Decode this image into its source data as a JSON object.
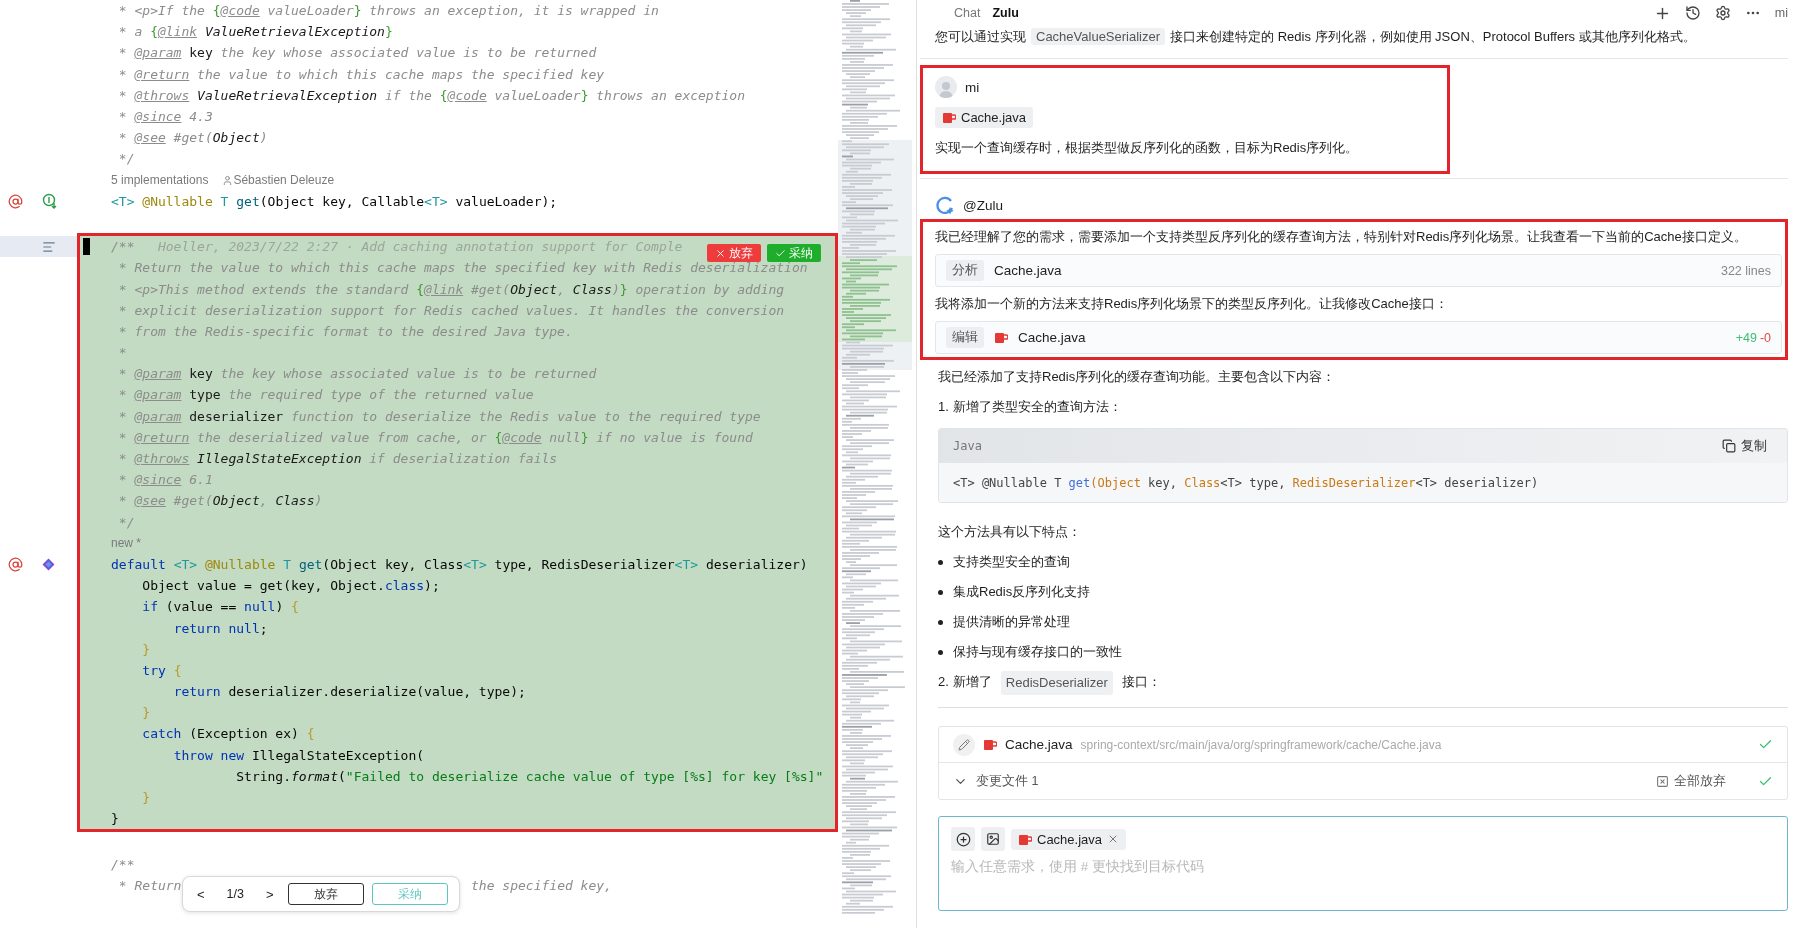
{
  "editor": {
    "lines_before": [
      {
        "kind": "code",
        "tokens": [
          {
            "kind": "comment",
            "text": " * <p>If the "
          },
          {
            "kind": "docbrace",
            "text": "{"
          },
          {
            "kind": "doctag",
            "text": "@code"
          },
          {
            "kind": "comment",
            "text": " valueLoader"
          },
          {
            "kind": "docbrace",
            "text": "}"
          },
          {
            "kind": "comment",
            "text": " throws an exception, it is wrapped in"
          }
        ]
      },
      {
        "kind": "code",
        "tokens": [
          {
            "kind": "comment",
            "text": " * a "
          },
          {
            "kind": "docbrace",
            "text": "{"
          },
          {
            "kind": "doctag",
            "text": "@link"
          },
          {
            "kind": "docref",
            "text": " ValueRetrievalException"
          },
          {
            "kind": "docbrace",
            "text": "}"
          }
        ]
      },
      {
        "kind": "code",
        "tokens": [
          {
            "kind": "comment",
            "text": " * "
          },
          {
            "kind": "doctag",
            "text": "@param"
          },
          {
            "kind": "docparam",
            "text": " key"
          },
          {
            "kind": "comment",
            "text": " the key whose associated value is to be returned"
          }
        ]
      },
      {
        "kind": "code",
        "tokens": [
          {
            "kind": "comment",
            "text": " * "
          },
          {
            "kind": "doctag",
            "text": "@return"
          },
          {
            "kind": "comment",
            "text": " the value to which this cache maps the specified key"
          }
        ]
      },
      {
        "kind": "code",
        "tokens": [
          {
            "kind": "comment",
            "text": " * "
          },
          {
            "kind": "doctag",
            "text": "@throws"
          },
          {
            "kind": "docref",
            "text": " ValueRetrievalException"
          },
          {
            "kind": "comment",
            "text": " if the "
          },
          {
            "kind": "docbrace",
            "text": "{"
          },
          {
            "kind": "doctag",
            "text": "@code"
          },
          {
            "kind": "comment",
            "text": " valueLoader"
          },
          {
            "kind": "docbrace",
            "text": "}"
          },
          {
            "kind": "comment",
            "text": " throws an exception"
          }
        ]
      },
      {
        "kind": "code",
        "tokens": [
          {
            "kind": "comment",
            "text": " * "
          },
          {
            "kind": "doctag",
            "text": "@since"
          },
          {
            "kind": "comment",
            "text": " 4.3"
          }
        ]
      },
      {
        "kind": "code",
        "tokens": [
          {
            "kind": "comment",
            "text": " * "
          },
          {
            "kind": "doctag",
            "text": "@see"
          },
          {
            "kind": "comment",
            "text": " #get("
          },
          {
            "kind": "docref",
            "text": "Object"
          },
          {
            "kind": "comment",
            "text": ")"
          }
        ]
      },
      {
        "kind": "code",
        "tokens": [
          {
            "kind": "comment",
            "text": " */"
          }
        ]
      },
      {
        "kind": "inlay",
        "items": [
          {
            "kind": "usages",
            "text": "5 implementations"
          },
          {
            "kind": "author",
            "text": "Sébastien Deleuze"
          }
        ]
      },
      {
        "kind": "code",
        "markers": [
          {
            "kind": "override"
          },
          {
            "kind": "implemented"
          }
        ],
        "tokens": [
          {
            "kind": "typeparam",
            "text": "<T> "
          },
          {
            "kind": "annotation",
            "text": "@Nullable "
          },
          {
            "kind": "typeparam",
            "text": "T "
          },
          {
            "kind": "method",
            "text": "get"
          },
          {
            "kind": "plain",
            "text": "(Object key, Callable"
          },
          {
            "kind": "typeparam",
            "text": "<T>"
          },
          {
            "kind": "plain",
            "text": " valueLoader);"
          }
        ]
      },
      {
        "kind": "blank"
      }
    ],
    "diff_block": {
      "highlighted": true,
      "actions": [
        {
          "kind": "reject",
          "label": "放弃"
        },
        {
          "kind": "accept",
          "label": "采纳"
        }
      ],
      "lines": [
        {
          "kind": "code",
          "current": true,
          "markers": [
            {
              "kind": "outline"
            }
          ],
          "tokens": [
            {
              "kind": "comment",
              "text": "/**"
            },
            {
              "kind": "hint",
              "text": "   Hoeller, 2023/7/22 2:27 · Add caching annotation support for Comple"
            }
          ]
        },
        {
          "kind": "code",
          "tokens": [
            {
              "kind": "comment",
              "text": " * Return the value to which this cache maps the specified key with Redis deserialization"
            }
          ]
        },
        {
          "kind": "code",
          "tokens": [
            {
              "kind": "comment",
              "text": " * <p>This method extends the standard "
            },
            {
              "kind": "docbrace",
              "text": "{"
            },
            {
              "kind": "doctag",
              "text": "@link"
            },
            {
              "kind": "comment",
              "text": " #get("
            },
            {
              "kind": "docref",
              "text": "Object"
            },
            {
              "kind": "comment",
              "text": ", "
            },
            {
              "kind": "docref",
              "text": "Class"
            },
            {
              "kind": "comment",
              "text": ")"
            },
            {
              "kind": "docbrace",
              "text": "}"
            },
            {
              "kind": "comment",
              "text": " operation by adding"
            }
          ]
        },
        {
          "kind": "code",
          "tokens": [
            {
              "kind": "comment",
              "text": " * explicit deserialization support for Redis cached values. It handles the conversion"
            }
          ]
        },
        {
          "kind": "code",
          "tokens": [
            {
              "kind": "comment",
              "text": " * from the Redis-specific format to the desired Java type."
            }
          ]
        },
        {
          "kind": "code",
          "tokens": [
            {
              "kind": "comment",
              "text": " *"
            }
          ]
        },
        {
          "kind": "code",
          "tokens": [
            {
              "kind": "comment",
              "text": " * "
            },
            {
              "kind": "doctag",
              "text": "@param"
            },
            {
              "kind": "docparam",
              "text": " key"
            },
            {
              "kind": "comment",
              "text": " the key whose associated value is to be returned"
            }
          ]
        },
        {
          "kind": "code",
          "tokens": [
            {
              "kind": "comment",
              "text": " * "
            },
            {
              "kind": "doctag",
              "text": "@param"
            },
            {
              "kind": "docparam",
              "text": " type"
            },
            {
              "kind": "comment",
              "text": " the required type of the returned value"
            }
          ]
        },
        {
          "kind": "code",
          "tokens": [
            {
              "kind": "comment",
              "text": " * "
            },
            {
              "kind": "doctag",
              "text": "@param"
            },
            {
              "kind": "docparam",
              "text": " deserializer"
            },
            {
              "kind": "comment",
              "text": " function to deserialize the Redis value to the required type"
            }
          ]
        },
        {
          "kind": "code",
          "tokens": [
            {
              "kind": "comment",
              "text": " * "
            },
            {
              "kind": "doctag",
              "text": "@return"
            },
            {
              "kind": "comment",
              "text": " the deserialized value from cache, or "
            },
            {
              "kind": "docbrace",
              "text": "{"
            },
            {
              "kind": "doctag",
              "text": "@code"
            },
            {
              "kind": "comment",
              "text": " null"
            },
            {
              "kind": "docbrace",
              "text": "}"
            },
            {
              "kind": "comment",
              "text": " if no value is found"
            }
          ]
        },
        {
          "kind": "code",
          "tokens": [
            {
              "kind": "comment",
              "text": " * "
            },
            {
              "kind": "doctag",
              "text": "@throws"
            },
            {
              "kind": "docref",
              "text": " IllegalStateException"
            },
            {
              "kind": "comment",
              "text": " if deserialization fails"
            }
          ]
        },
        {
          "kind": "code",
          "tokens": [
            {
              "kind": "comment",
              "text": " * "
            },
            {
              "kind": "doctag",
              "text": "@since"
            },
            {
              "kind": "comment",
              "text": " 6.1"
            }
          ]
        },
        {
          "kind": "code",
          "tokens": [
            {
              "kind": "comment",
              "text": " * "
            },
            {
              "kind": "doctag",
              "text": "@see"
            },
            {
              "kind": "comment",
              "text": " #get("
            },
            {
              "kind": "docref",
              "text": "Object"
            },
            {
              "kind": "comment",
              "text": ", "
            },
            {
              "kind": "docref",
              "text": "Class"
            },
            {
              "kind": "comment",
              "text": ")"
            }
          ]
        },
        {
          "kind": "code",
          "tokens": [
            {
              "kind": "comment",
              "text": " */"
            }
          ]
        },
        {
          "kind": "inlay",
          "items": [
            {
              "kind": "usages",
              "text": "new *"
            }
          ]
        },
        {
          "kind": "code",
          "markers": [
            {
              "kind": "override"
            },
            {
              "kind": "target"
            }
          ],
          "tokens": [
            {
              "kind": "keyword",
              "text": "default "
            },
            {
              "kind": "typeparam",
              "text": "<T> "
            },
            {
              "kind": "annotation",
              "text": "@Nullable "
            },
            {
              "kind": "typeparam",
              "text": "T "
            },
            {
              "kind": "method",
              "text": "get"
            },
            {
              "kind": "plain",
              "text": "(Object key, Class"
            },
            {
              "kind": "typeparam",
              "text": "<T>"
            },
            {
              "kind": "plain",
              "text": " type, RedisDeserializer"
            },
            {
              "kind": "typeparam",
              "text": "<T>"
            },
            {
              "kind": "plain",
              "text": " deserializer)"
            }
          ]
        },
        {
          "kind": "code",
          "tokens": [
            {
              "kind": "plain",
              "text": "    Object value = get(key, Object."
            },
            {
              "kind": "keyword",
              "text": "class"
            },
            {
              "kind": "plain",
              "text": ");"
            }
          ]
        },
        {
          "kind": "code",
          "tokens": [
            {
              "kind": "keyword",
              "text": "    if"
            },
            {
              "kind": "plain",
              "text": " (value == "
            },
            {
              "kind": "keyword",
              "text": "null"
            },
            {
              "kind": "plain",
              "text": ") "
            },
            {
              "kind": "brace",
              "text": "{"
            }
          ]
        },
        {
          "kind": "code",
          "tokens": [
            {
              "kind": "keyword",
              "text": "        return null"
            },
            {
              "kind": "plain",
              "text": ";"
            }
          ]
        },
        {
          "kind": "code",
          "tokens": [
            {
              "kind": "brace",
              "text": "    }"
            }
          ]
        },
        {
          "kind": "code",
          "tokens": [
            {
              "kind": "keyword",
              "text": "    try "
            },
            {
              "kind": "brace",
              "text": "{"
            }
          ]
        },
        {
          "kind": "code",
          "tokens": [
            {
              "kind": "keyword",
              "text": "        return"
            },
            {
              "kind": "plain",
              "text": " deserializer.deserialize(value, type);"
            }
          ]
        },
        {
          "kind": "code",
          "tokens": [
            {
              "kind": "brace",
              "text": "    }"
            }
          ]
        },
        {
          "kind": "code",
          "tokens": [
            {
              "kind": "keyword",
              "text": "    catch"
            },
            {
              "kind": "plain",
              "text": " (Exception ex) "
            },
            {
              "kind": "brace",
              "text": "{"
            }
          ]
        },
        {
          "kind": "code",
          "tokens": [
            {
              "kind": "keyword",
              "text": "        throw new"
            },
            {
              "kind": "plain",
              "text": " IllegalStateException("
            }
          ]
        },
        {
          "kind": "code",
          "tokens": [
            {
              "kind": "plain",
              "text": "                String."
            },
            {
              "kind": "italic",
              "text": "format"
            },
            {
              "kind": "plain",
              "text": "("
            },
            {
              "kind": "string",
              "text": "\"Failed to deserialize cache value of type [%s] for key [%s]\""
            }
          ]
        },
        {
          "kind": "code",
          "tokens": [
            {
              "kind": "brace",
              "text": "    }"
            }
          ]
        },
        {
          "kind": "code",
          "tokens": [
            {
              "kind": "plain",
              "text": "}"
            }
          ]
        }
      ]
    },
    "lines_after": [
      {
        "kind": "blank"
      },
      {
        "kind": "code",
        "tokens": [
          {
            "kind": "comment",
            "text": "/**"
          }
        ]
      },
      {
        "kind": "code",
        "tokens": [
          {
            "kind": "comment",
            "text": " * Return"
          },
          {
            "kind": "comment",
            "text": "                                     the specified key,"
          }
        ]
      }
    ],
    "diff_navigator": {
      "prev": "<",
      "counter": "1/3",
      "next": ">",
      "reject": "放弃",
      "accept": "采纳"
    }
  },
  "chat": {
    "tabs": [
      {
        "label": "Chat",
        "selected": false
      },
      {
        "label": "Zulu",
        "selected": true
      }
    ],
    "user_label": "mi",
    "intro": {
      "before": "您可以通过实现",
      "code": "CacheValueSerializer",
      "after": "接口来创建特定的 Redis 序列化器，例如使用 JSON、Protocol Buffers 或其他序列化格式。"
    },
    "user_message": {
      "author": "mi",
      "highlighted": true,
      "attachment": "Cache.java",
      "text": "实现一个查询缓存时，根据类型做反序列化的函数，目标为Redis序列化。"
    },
    "reply": {
      "author": "@Zulu",
      "highlighted": true,
      "steps": [
        {
          "kind": "text",
          "text": "我已经理解了您的需求，需要添加一个支持类型反序列化的缓存查询方法，特别针对Redis序列化场景。让我查看一下当前的Cache接口定义。"
        },
        {
          "kind": "tool",
          "action": "分析",
          "file_icon": false,
          "file": "Cache.java",
          "info": "322 lines"
        },
        {
          "kind": "text",
          "text": "我将添加一个新的方法来支持Redis序列化场景下的类型反序列化。让我修改Cache接口："
        },
        {
          "kind": "tool",
          "action": "编辑",
          "file_icon": true,
          "file": "Cache.java",
          "added": "+49",
          "removed": "-0"
        }
      ],
      "body": [
        {
          "kind": "paragraph",
          "text": "我已经添加了支持Redis序列化的缓存查询功能。主要包含以下内容："
        },
        {
          "kind": "numbered",
          "number": "1.",
          "text": "新增了类型安全的查询方法："
        },
        {
          "kind": "code",
          "language": "Java",
          "copy": "复制",
          "tokens": [
            {
              "kind": "plain",
              "text": "<T> @Nullable T "
            },
            {
              "kind": "method",
              "text": "get"
            },
            {
              "kind": "type",
              "text": "(Object"
            },
            {
              "kind": "plain",
              "text": " key, "
            },
            {
              "kind": "type",
              "text": "Class"
            },
            {
              "kind": "plain",
              "text": "<T> type, "
            },
            {
              "kind": "type",
              "text": "RedisDeserializer"
            },
            {
              "kind": "plain",
              "text": "<T> deserializer)"
            }
          ]
        },
        {
          "kind": "paragraph",
          "text": "这个方法具有以下特点："
        },
        {
          "kind": "bullet",
          "text": "支持类型安全的查询"
        },
        {
          "kind": "bullet",
          "text": "集成Redis反序列化支持"
        },
        {
          "kind": "bullet",
          "text": "提供清晰的异常处理"
        },
        {
          "kind": "bullet",
          "text": "保持与现有缓存接口的一致性"
        },
        {
          "kind": "numbered",
          "number": "2.",
          "before": "新增了",
          "code": "RedisDeserializer",
          "after": "接口："
        }
      ]
    },
    "changes": {
      "file": "Cache.java",
      "path": "spring-context/src/main/java/org/springframework/cache/Cache.java",
      "accepted": true,
      "summary": "变更文件 1",
      "discard_all": "全部放弃",
      "all_accepted": true
    },
    "input": {
      "attachment": "Cache.java",
      "placeholder": "输入任意需求，使用 # 更快找到目标代码"
    }
  }
}
